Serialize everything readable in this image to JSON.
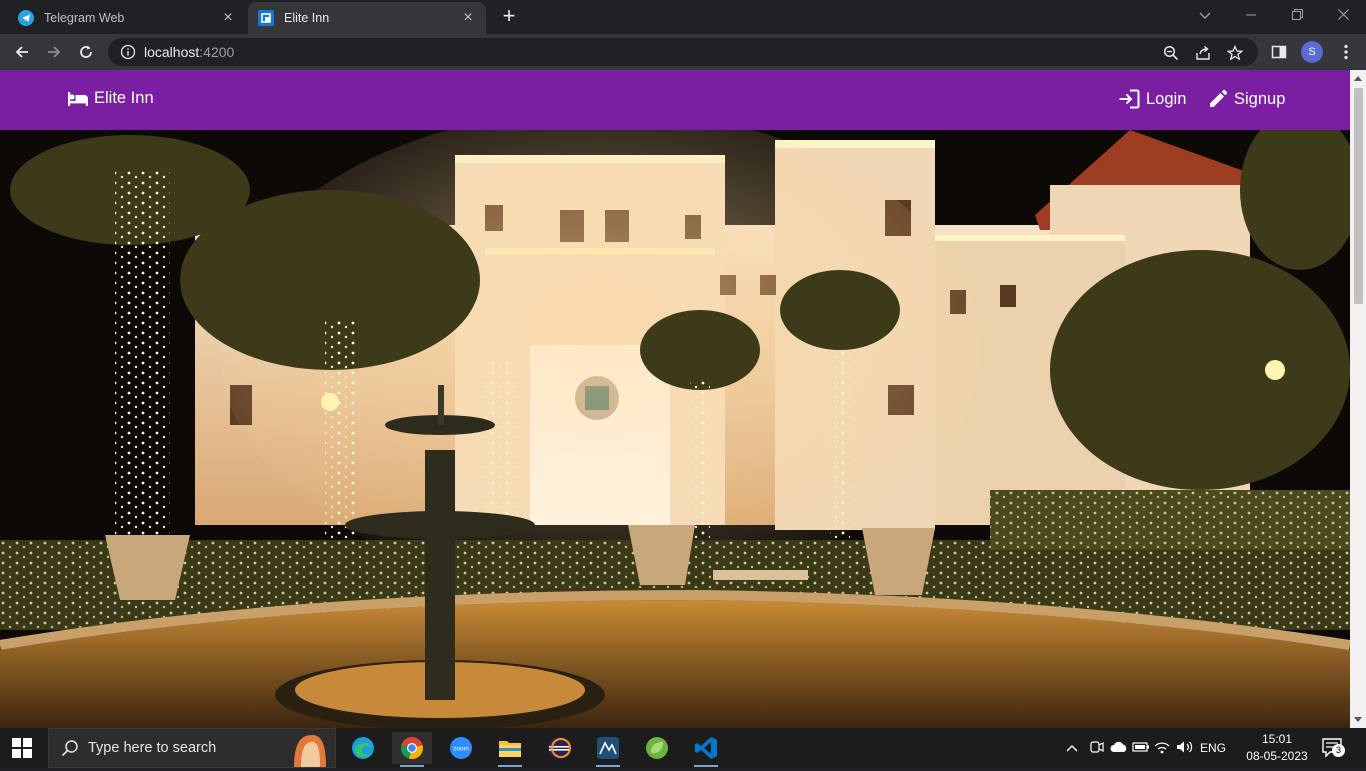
{
  "browser": {
    "tabs": [
      {
        "title": "Telegram Web",
        "active": false
      },
      {
        "title": "Elite Inn",
        "active": true
      }
    ],
    "url_host": "localhost",
    "url_port": ":4200",
    "profile_initial": "S"
  },
  "page": {
    "brand": "Elite Inn",
    "nav": [
      {
        "label": "Login",
        "icon": "login-icon"
      },
      {
        "label": "Signup",
        "icon": "pencil-icon"
      }
    ],
    "hero_alt": "Illuminated hotel with fountain at night",
    "navbar_color": "#7b1fa2"
  },
  "taskbar": {
    "search_placeholder": "Type here to search",
    "apps": [
      "edge-icon",
      "chrome-icon",
      "zoom-icon",
      "file-explorer-icon",
      "eclipse-icon",
      "mysql-workbench-icon",
      "spring-tools-icon",
      "vscode-icon"
    ],
    "language": "ENG",
    "time": "15:01",
    "date": "08-05-2023",
    "notification_count": "3"
  }
}
